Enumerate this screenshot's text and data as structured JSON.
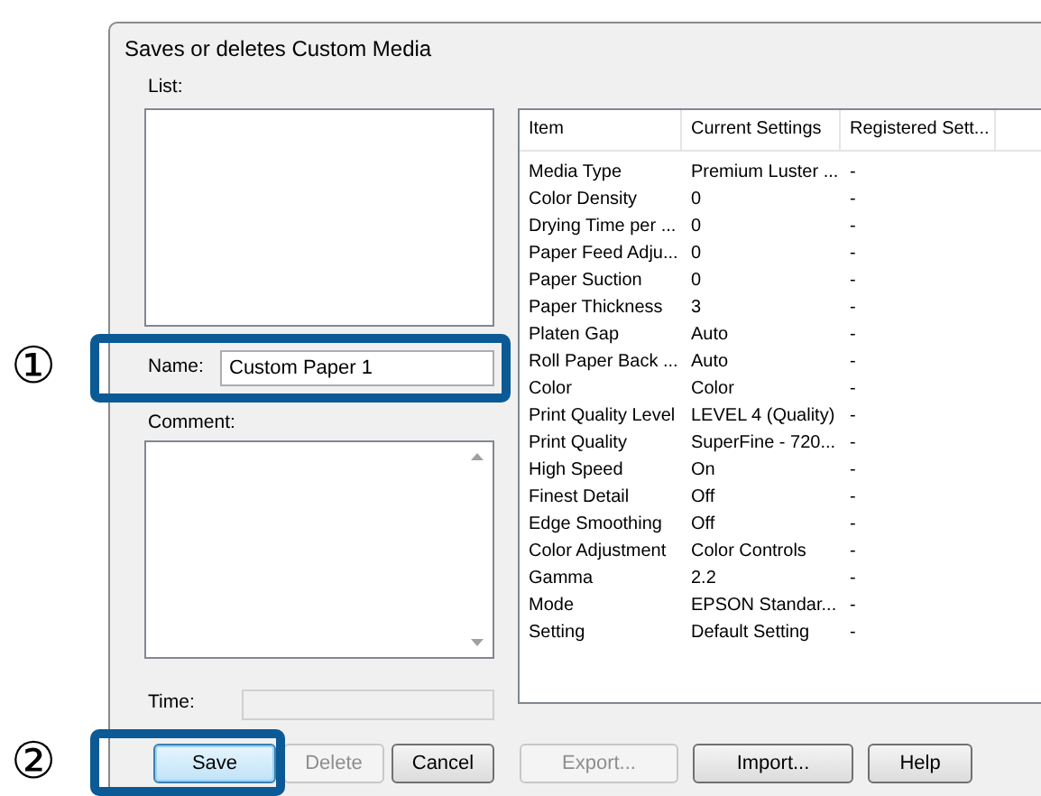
{
  "callouts": [
    {
      "number": "①"
    },
    {
      "number": "②"
    }
  ],
  "dialog": {
    "title": "Saves or deletes Custom Media",
    "list": {
      "label": "List:"
    },
    "name": {
      "label": "Name:",
      "value": "Custom Paper 1"
    },
    "comment": {
      "label": "Comment:"
    },
    "time": {
      "label": "Time:"
    },
    "table": {
      "columns": [
        "Item",
        "Current Settings",
        "Registered Sett..."
      ],
      "rows": [
        [
          "Media Type",
          "Premium Luster ...",
          "-"
        ],
        [
          "Color Density",
          "0",
          "-"
        ],
        [
          "Drying Time per ...",
          "0",
          "-"
        ],
        [
          "Paper Feed Adju...",
          "0",
          "-"
        ],
        [
          "Paper Suction",
          "0",
          "-"
        ],
        [
          "Paper Thickness",
          "3",
          "-"
        ],
        [
          "Platen Gap",
          "Auto",
          "-"
        ],
        [
          "Roll Paper Back ...",
          "Auto",
          "-"
        ],
        [
          "Color",
          "Color",
          "-"
        ],
        [
          "Print Quality Level",
          "LEVEL 4 (Quality)",
          "-"
        ],
        [
          "Print Quality",
          "SuperFine - 720...",
          "-"
        ],
        [
          "High Speed",
          "On",
          "-"
        ],
        [
          "Finest Detail",
          "Off",
          "-"
        ],
        [
          "Edge Smoothing",
          "Off",
          "-"
        ],
        [
          "Color Adjustment",
          "Color Controls",
          "-"
        ],
        [
          "Gamma",
          "2.2",
          "-"
        ],
        [
          "Mode",
          "EPSON Standar...",
          "-"
        ],
        [
          "Setting",
          "Default Setting",
          "-"
        ]
      ]
    },
    "buttons": [
      {
        "label": "Save",
        "disabled": false,
        "default": true
      },
      {
        "label": "Delete",
        "disabled": true,
        "default": false
      },
      {
        "label": "Cancel",
        "disabled": false,
        "default": false
      },
      {
        "label": "Export...",
        "disabled": true,
        "default": false
      },
      {
        "label": "Import...",
        "disabled": false,
        "default": false
      },
      {
        "label": "Help",
        "disabled": false,
        "default": false
      }
    ]
  }
}
